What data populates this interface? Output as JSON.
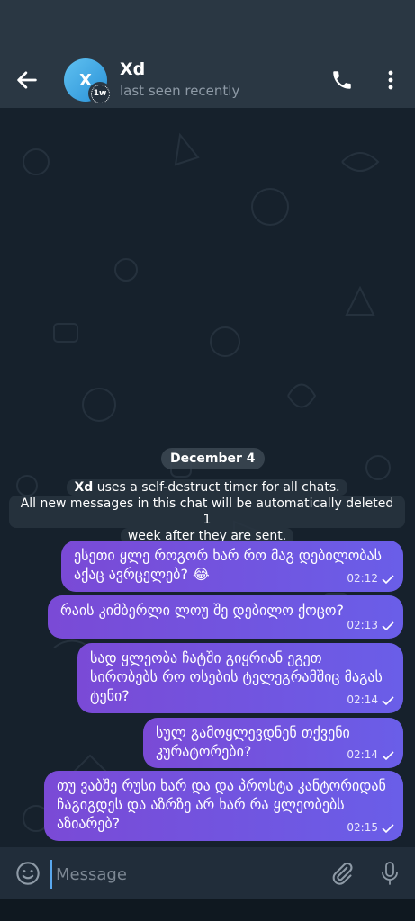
{
  "header": {
    "avatar_letter": "X",
    "timer_badge": "1w",
    "title": "Xd",
    "status": "last seen recently",
    "icons": [
      "back-arrow-icon",
      "phone-icon",
      "more-vertical-icon",
      "timer-icon"
    ]
  },
  "chat": {
    "date": "December 4",
    "service": {
      "name": "Xd",
      "line1_rest": " uses a self-destruct timer for all chats.",
      "line2": "All new messages in this chat will be automatically deleted 1",
      "line3": "week after they are sent."
    },
    "messages": [
      {
        "text": "ესეთი ყლე როგორ ხარ რო მაგ დებილობას აქაც ავრცელებ? 😂",
        "time": "02:12"
      },
      {
        "text": "რაის კიმბერლი ლოუ შე დებილო ქოცო?",
        "time": "02:13"
      },
      {
        "text": "სად ყლეობა ჩატში გიყრიან ეგეთ სირობებს რო ოსების ტელეგრამშიც მაგას ტენი?",
        "time": "02:14"
      },
      {
        "text": "სულ გამოყლევდნენ თქვენი კურატორები?",
        "time": "02:14"
      },
      {
        "text": "თუ ვაბშე რუსი ხარ და და პროსტა კანტორიდან ჩაგიგდეს და აზრზე არ ხარ რა ყლეობებს აზიარებ?",
        "time": "02:15"
      }
    ]
  },
  "input": {
    "placeholder": "Message",
    "icons": [
      "emoji-icon",
      "attach-icon",
      "mic-icon"
    ]
  },
  "colors": {
    "header_bg": "#2a3743",
    "chat_bg": "#16212c",
    "bubble_gradient_start": "#7a4ad6",
    "bubble_gradient_end": "#6a5ee8",
    "accent": "#5aa8ee"
  }
}
